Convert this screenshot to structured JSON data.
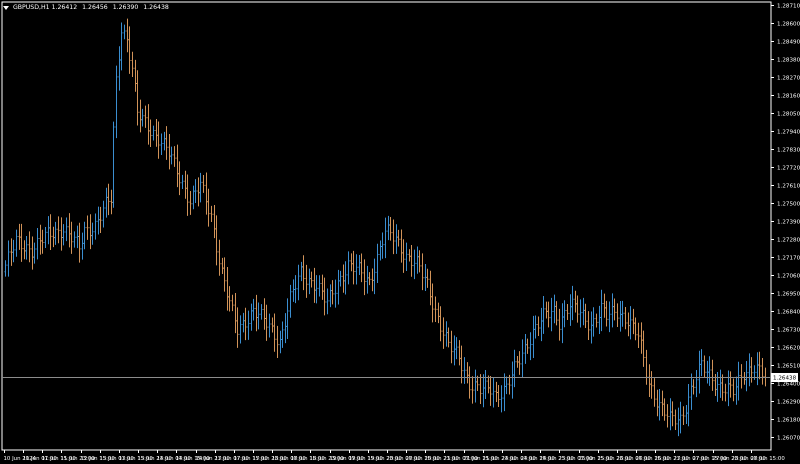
{
  "header": {
    "symbol": "GBPUSD,H1",
    "open": "1.26412",
    "high": "1.26456",
    "low": "1.26390",
    "close": "1.26438"
  },
  "colors": {
    "background": "#000000",
    "bull": "#3B8ED0",
    "bear": "#D19359",
    "axis": "#FFFFFF",
    "price_line": "#8C8C8C"
  },
  "chart_data": {
    "type": "bar",
    "instrument": "GBPUSD",
    "timeframe": "H1",
    "current_price": "1.26438",
    "y_ticks": [
      "1.28710",
      "1.28600",
      "1.28490",
      "1.28380",
      "1.28270",
      "1.28160",
      "1.28050",
      "1.27940",
      "1.27830",
      "1.27720",
      "1.27610",
      "1.27500",
      "1.27390",
      "1.27280",
      "1.27170",
      "1.27060",
      "1.26950",
      "1.26840",
      "1.26730",
      "1.26620",
      "1.26510",
      "1.26400",
      "1.26290",
      "1.26180",
      "1.26070"
    ],
    "x_ticks": [
      "10 Jun 2024",
      "11 Jun 07:00",
      "11 Jun 15:00",
      "11 Jun 23:00",
      "12 Jun 15:00",
      "13 Jun 07:00",
      "13 Jun 15:00",
      "13 Jun 23:00",
      "14 Jun 07:00",
      "14 Jun 15:00",
      "14 Jun 23:00",
      "17 Jun 07:00",
      "17 Jun 15:00",
      "17 Jun 23:00",
      "18 Jun 07:00",
      "18 Jun 15:00",
      "18 Jun 23:00",
      "19 Jun 07:00",
      "19 Jun 15:00",
      "19 Jun 23:00",
      "20 Jun 07:00",
      "20 Jun 15:00",
      "20 Jun 23:00",
      "21 Jun 07:00",
      "21 Jun 15:00",
      "21 Jun 23:00",
      "24 Jun 07:00",
      "24 Jun 15:00",
      "24 Jun 23:00",
      "25 Jun 07:00",
      "25 Jun 15:00",
      "25 Jun 23:00",
      "26 Jun 07:00",
      "26 Jun 15:00",
      "26 Jun 23:00",
      "27 Jun 07:00",
      "27 Jun 15:00",
      "27 Jun 23:00",
      "28 Jun 07:00",
      "28 Jun 15:00"
    ],
    "ylim": [
      1.2605,
      1.2873
    ],
    "close_path": [
      [
        0,
        1.2712
      ],
      [
        4,
        1.2726
      ],
      [
        10,
        1.2722
      ],
      [
        16,
        1.273
      ],
      [
        22,
        1.2735
      ],
      [
        28,
        1.2722
      ],
      [
        30,
        1.2733
      ],
      [
        34,
        1.2737
      ],
      [
        38,
        1.2748
      ],
      [
        40,
        1.2752
      ],
      [
        41,
        1.2794
      ],
      [
        42,
        1.2825
      ],
      [
        44,
        1.2858
      ],
      [
        46,
        1.285
      ],
      [
        48,
        1.2832
      ],
      [
        50,
        1.2804
      ],
      [
        54,
        1.2797
      ],
      [
        58,
        1.279
      ],
      [
        62,
        1.278
      ],
      [
        66,
        1.2766
      ],
      [
        70,
        1.2752
      ],
      [
        74,
        1.276
      ],
      [
        78,
        1.2742
      ],
      [
        82,
        1.2708
      ],
      [
        86,
        1.2682
      ],
      [
        88,
        1.2672
      ],
      [
        94,
        1.2685
      ],
      [
        100,
        1.2674
      ],
      [
        104,
        1.2666
      ],
      [
        108,
        1.2691
      ],
      [
        112,
        1.2707
      ],
      [
        118,
        1.27
      ],
      [
        122,
        1.2688
      ],
      [
        126,
        1.2702
      ],
      [
        130,
        1.2712
      ],
      [
        134,
        1.2708
      ],
      [
        138,
        1.2702
      ],
      [
        140,
        1.2712
      ],
      [
        144,
        1.2732
      ],
      [
        148,
        1.2728
      ],
      [
        152,
        1.2718
      ],
      [
        156,
        1.2712
      ],
      [
        160,
        1.27
      ],
      [
        164,
        1.268
      ],
      [
        168,
        1.2662
      ],
      [
        172,
        1.2656
      ],
      [
        176,
        1.264
      ],
      [
        180,
        1.2635
      ],
      [
        184,
        1.2637
      ],
      [
        186,
        1.2633
      ],
      [
        190,
        1.2637
      ],
      [
        196,
        1.2658
      ],
      [
        200,
        1.2672
      ],
      [
        204,
        1.268
      ],
      [
        208,
        1.2684
      ],
      [
        210,
        1.2678
      ],
      [
        214,
        1.2688
      ],
      [
        218,
        1.2682
      ],
      [
        222,
        1.2676
      ],
      [
        226,
        1.2685
      ],
      [
        228,
        1.268
      ],
      [
        232,
        1.2684
      ],
      [
        236,
        1.2679
      ],
      [
        240,
        1.2668
      ],
      [
        244,
        1.264
      ],
      [
        248,
        1.2627
      ],
      [
        252,
        1.2617
      ],
      [
        256,
        1.2618
      ],
      [
        260,
        1.2636
      ],
      [
        264,
        1.265
      ],
      [
        268,
        1.2643
      ],
      [
        272,
        1.2637
      ],
      [
        276,
        1.2634
      ],
      [
        280,
        1.2647
      ],
      [
        284,
        1.265
      ],
      [
        288,
        1.2643
      ]
    ]
  }
}
